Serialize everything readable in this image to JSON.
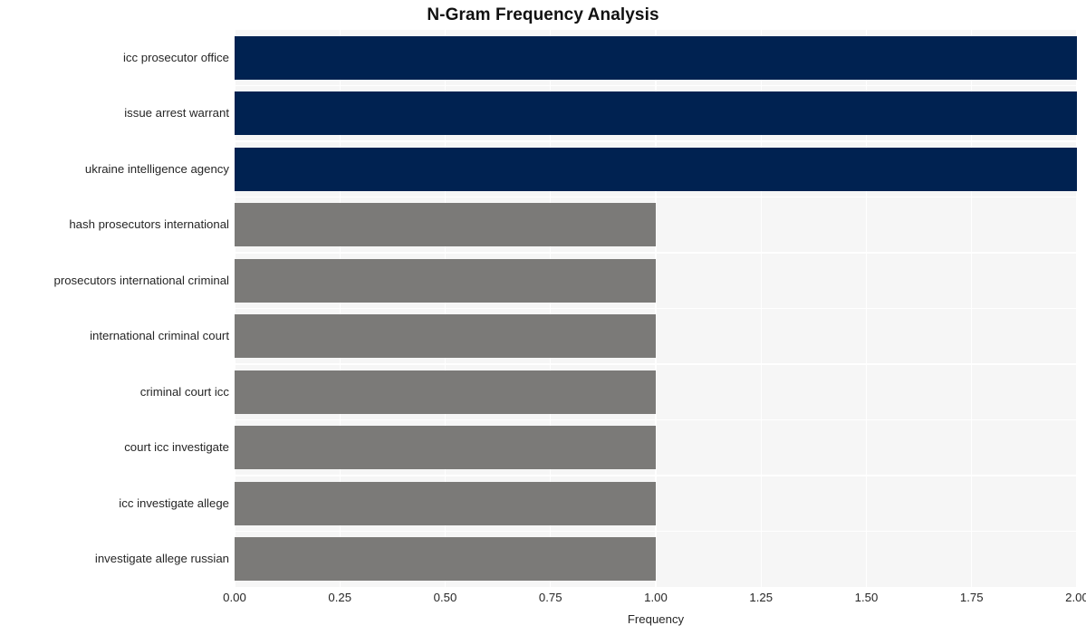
{
  "chart_data": {
    "type": "bar",
    "orientation": "horizontal",
    "title": "N-Gram Frequency Analysis",
    "xlabel": "Frequency",
    "ylabel": "",
    "xlim": [
      0,
      2.0
    ],
    "xticks": [
      "0.00",
      "0.25",
      "0.50",
      "0.75",
      "1.00",
      "1.25",
      "1.50",
      "1.75",
      "2.00"
    ],
    "xtick_values": [
      0,
      0.25,
      0.5,
      0.75,
      1.0,
      1.25,
      1.5,
      1.75,
      2.0
    ],
    "grid": true,
    "legend": "none",
    "categories": [
      "icc prosecutor office",
      "issue arrest warrant",
      "ukraine intelligence agency",
      "hash prosecutors international",
      "prosecutors international criminal",
      "international criminal court",
      "criminal court icc",
      "court icc investigate",
      "icc investigate allege",
      "investigate allege russian"
    ],
    "values": [
      2,
      2,
      2,
      1,
      1,
      1,
      1,
      1,
      1,
      1
    ],
    "bar_colors": [
      "#002251",
      "#002251",
      "#002251",
      "#7b7a78",
      "#7b7a78",
      "#7b7a78",
      "#7b7a78",
      "#7b7a78",
      "#7b7a78",
      "#7b7a78"
    ],
    "colors": {
      "highlight": "#002251",
      "base": "#7b7a78",
      "plot_background": "#f6f6f6",
      "figure_background": "#ffffff",
      "gridline": "#ffffff",
      "text": "#262626",
      "title": "#111111"
    }
  }
}
